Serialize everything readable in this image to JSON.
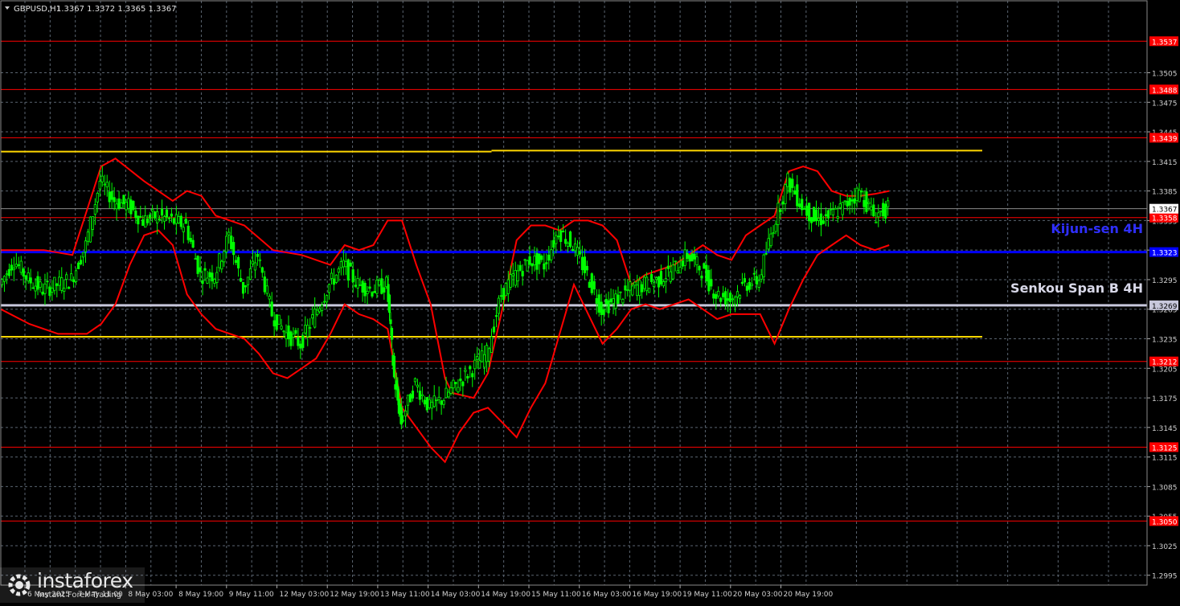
{
  "header": {
    "symbol": "GBPUSD,H1",
    "ohlc": "1.3367 1.3372 1.3365 1.3367"
  },
  "colors": {
    "background": "#000000",
    "grid": "#5a6470",
    "candles": "#00ff00",
    "ichimoku": "#ff0000",
    "support_resistance": "#ff0000",
    "yellow_lines": "#ffd700",
    "kijun": "#0000ff",
    "senkou": "#c8c8dc",
    "current_price": "#8a8a8a"
  },
  "annotations": {
    "kijun_label": "Kijun-sen 4H",
    "senkou_label": "Senkou Span B 4H"
  },
  "watermark": {
    "brand": "instaforex",
    "tagline": "Instant Forex Trading",
    "icon": "gear-logo-icon"
  },
  "chart_data": {
    "type": "candlestick",
    "title": "GBPUSD,H1",
    "ylim": [
      1.2985,
      1.3578
    ],
    "y_ticks": [
      "1.3505",
      "1.3475",
      "1.3445",
      "1.3415",
      "1.3385",
      "1.3355",
      "1.3325",
      "1.3295",
      "1.3265",
      "1.3235",
      "1.3205",
      "1.3175",
      "1.3145",
      "1.3115",
      "1.3085",
      "1.3055",
      "1.3025",
      "1.2995"
    ],
    "x_ticks": [
      "6 May 2025",
      "7 May 11:00",
      "8 May 03:00",
      "8 May 19:00",
      "9 May 11:00",
      "12 May 03:00",
      "12 May 19:00",
      "13 May 11:00",
      "14 May 03:00",
      "14 May 19:00",
      "15 May 11:00",
      "16 May 03:00",
      "16 May 19:00",
      "19 May 11:00",
      "20 May 03:00",
      "20 May 19:00"
    ],
    "price_levels": [
      {
        "value": 1.3537,
        "label": "1.3537",
        "color": "#ff0000"
      },
      {
        "value": 1.3488,
        "label": "1.3488",
        "color": "#ff0000"
      },
      {
        "value": 1.3439,
        "label": "1.3439",
        "color": "#ff0000"
      },
      {
        "value": 1.3358,
        "label": "1.3358",
        "color": "#ff0000"
      },
      {
        "value": 1.3323,
        "label": "1.3323",
        "color": "#0000ff"
      },
      {
        "value": 1.3269,
        "label": "1.3269",
        "color": "#c8c8dc"
      },
      {
        "value": 1.3212,
        "label": "1.3212",
        "color": "#ff0000"
      },
      {
        "value": 1.3125,
        "label": "1.3125",
        "color": "#ff0000"
      },
      {
        "value": 1.305,
        "label": "1.3050",
        "color": "#ff0000"
      }
    ],
    "current_price": {
      "value": 1.3367,
      "label": "1.3367"
    },
    "yellow_lines": [
      {
        "x_from": 0,
        "x_to": 0.5,
        "y": 1.3425
      },
      {
        "x_from": 0.5,
        "x_to": 1.0,
        "y": 1.3426
      },
      {
        "x_from": 0,
        "x_to": 1.0,
        "y": 1.3237
      }
    ],
    "close_path": [
      [
        0,
        1.329
      ],
      [
        2,
        1.3315
      ],
      [
        4,
        1.3295
      ],
      [
        6,
        1.3285
      ],
      [
        8,
        1.329
      ],
      [
        10,
        1.3295
      ],
      [
        12,
        1.333
      ],
      [
        14,
        1.3395
      ],
      [
        16,
        1.3375
      ],
      [
        18,
        1.337
      ],
      [
        20,
        1.3355
      ],
      [
        22,
        1.336
      ],
      [
        24,
        1.3355
      ],
      [
        26,
        1.335
      ],
      [
        28,
        1.33
      ],
      [
        30,
        1.33
      ],
      [
        32,
        1.334
      ],
      [
        34,
        1.3285
      ],
      [
        36,
        1.332
      ],
      [
        38,
        1.326
      ],
      [
        40,
        1.324
      ],
      [
        42,
        1.323
      ],
      [
        44,
        1.326
      ],
      [
        46,
        1.329
      ],
      [
        48,
        1.331
      ],
      [
        50,
        1.329
      ],
      [
        52,
        1.3285
      ],
      [
        54,
        1.329
      ],
      [
        55,
        1.3195
      ],
      [
        56,
        1.315
      ],
      [
        58,
        1.319
      ],
      [
        60,
        1.3165
      ],
      [
        62,
        1.3175
      ],
      [
        64,
        1.319
      ],
      [
        66,
        1.3205
      ],
      [
        68,
        1.322
      ],
      [
        70,
        1.328
      ],
      [
        72,
        1.33
      ],
      [
        74,
        1.3315
      ],
      [
        76,
        1.331
      ],
      [
        78,
        1.3345
      ],
      [
        80,
        1.333
      ],
      [
        82,
        1.33
      ],
      [
        84,
        1.3265
      ],
      [
        86,
        1.3275
      ],
      [
        88,
        1.3285
      ],
      [
        90,
        1.329
      ],
      [
        92,
        1.3295
      ],
      [
        94,
        1.3305
      ],
      [
        96,
        1.332
      ],
      [
        98,
        1.3305
      ],
      [
        100,
        1.328
      ],
      [
        102,
        1.3275
      ],
      [
        104,
        1.329
      ],
      [
        106,
        1.3295
      ],
      [
        108,
        1.335
      ],
      [
        110,
        1.3395
      ],
      [
        112,
        1.337
      ],
      [
        114,
        1.3355
      ],
      [
        116,
        1.336
      ],
      [
        118,
        1.337
      ],
      [
        120,
        1.3385
      ],
      [
        122,
        1.336
      ],
      [
        124,
        1.3367
      ]
    ],
    "x_range": [
      0,
      160
    ],
    "ichimoku_upper": [
      [
        0,
        1.3325
      ],
      [
        6,
        1.3325
      ],
      [
        10,
        1.332
      ],
      [
        14,
        1.341
      ],
      [
        16,
        1.3418
      ],
      [
        20,
        1.3395
      ],
      [
        24,
        1.3375
      ],
      [
        26,
        1.3385
      ],
      [
        28,
        1.338
      ],
      [
        30,
        1.336
      ],
      [
        34,
        1.335
      ],
      [
        38,
        1.3325
      ],
      [
        42,
        1.332
      ],
      [
        44,
        1.3315
      ],
      [
        46,
        1.331
      ],
      [
        48,
        1.333
      ],
      [
        50,
        1.3325
      ],
      [
        52,
        1.333
      ],
      [
        54,
        1.3355
      ],
      [
        56,
        1.3355
      ],
      [
        58,
        1.331
      ],
      [
        60,
        1.327
      ],
      [
        62,
        1.3195
      ],
      [
        63,
        1.318
      ],
      [
        66,
        1.3175
      ],
      [
        68,
        1.32
      ],
      [
        70,
        1.3265
      ],
      [
        72,
        1.3335
      ],
      [
        74,
        1.335
      ],
      [
        76,
        1.335
      ],
      [
        78,
        1.3345
      ],
      [
        80,
        1.3355
      ],
      [
        82,
        1.3355
      ],
      [
        84,
        1.335
      ],
      [
        86,
        1.3335
      ],
      [
        88,
        1.329
      ],
      [
        90,
        1.33
      ],
      [
        92,
        1.3305
      ],
      [
        94,
        1.331
      ],
      [
        96,
        1.332
      ],
      [
        98,
        1.333
      ],
      [
        100,
        1.332
      ],
      [
        102,
        1.3315
      ],
      [
        104,
        1.334
      ],
      [
        106,
        1.335
      ],
      [
        108,
        1.336
      ],
      [
        110,
        1.3405
      ],
      [
        112,
        1.341
      ],
      [
        114,
        1.3405
      ],
      [
        116,
        1.3385
      ],
      [
        118,
        1.338
      ],
      [
        120,
        1.338
      ],
      [
        122,
        1.3382
      ],
      [
        124,
        1.3385
      ]
    ],
    "ichimoku_lower": [
      [
        0,
        1.3265
      ],
      [
        4,
        1.325
      ],
      [
        8,
        1.324
      ],
      [
        12,
        1.324
      ],
      [
        14,
        1.325
      ],
      [
        16,
        1.327
      ],
      [
        18,
        1.331
      ],
      [
        20,
        1.334
      ],
      [
        22,
        1.3345
      ],
      [
        24,
        1.333
      ],
      [
        26,
        1.328
      ],
      [
        28,
        1.326
      ],
      [
        30,
        1.3245
      ],
      [
        34,
        1.3235
      ],
      [
        36,
        1.322
      ],
      [
        38,
        1.32
      ],
      [
        40,
        1.3195
      ],
      [
        42,
        1.3205
      ],
      [
        44,
        1.3215
      ],
      [
        46,
        1.324
      ],
      [
        48,
        1.327
      ],
      [
        50,
        1.326
      ],
      [
        52,
        1.3255
      ],
      [
        54,
        1.3245
      ],
      [
        56,
        1.3165
      ],
      [
        58,
        1.3145
      ],
      [
        60,
        1.3125
      ],
      [
        62,
        1.311
      ],
      [
        64,
        1.314
      ],
      [
        66,
        1.316
      ],
      [
        68,
        1.3165
      ],
      [
        70,
        1.315
      ],
      [
        72,
        1.3135
      ],
      [
        74,
        1.3165
      ],
      [
        76,
        1.319
      ],
      [
        78,
        1.324
      ],
      [
        80,
        1.329
      ],
      [
        82,
        1.326
      ],
      [
        84,
        1.323
      ],
      [
        86,
        1.3245
      ],
      [
        88,
        1.3265
      ],
      [
        90,
        1.327
      ],
      [
        92,
        1.3265
      ],
      [
        94,
        1.327
      ],
      [
        96,
        1.3275
      ],
      [
        98,
        1.3265
      ],
      [
        100,
        1.3255
      ],
      [
        102,
        1.326
      ],
      [
        104,
        1.326
      ],
      [
        106,
        1.326
      ],
      [
        108,
        1.323
      ],
      [
        110,
        1.3265
      ],
      [
        112,
        1.3295
      ],
      [
        114,
        1.332
      ],
      [
        116,
        1.333
      ],
      [
        118,
        1.334
      ],
      [
        120,
        1.333
      ],
      [
        122,
        1.3325
      ],
      [
        124,
        1.333
      ]
    ]
  }
}
